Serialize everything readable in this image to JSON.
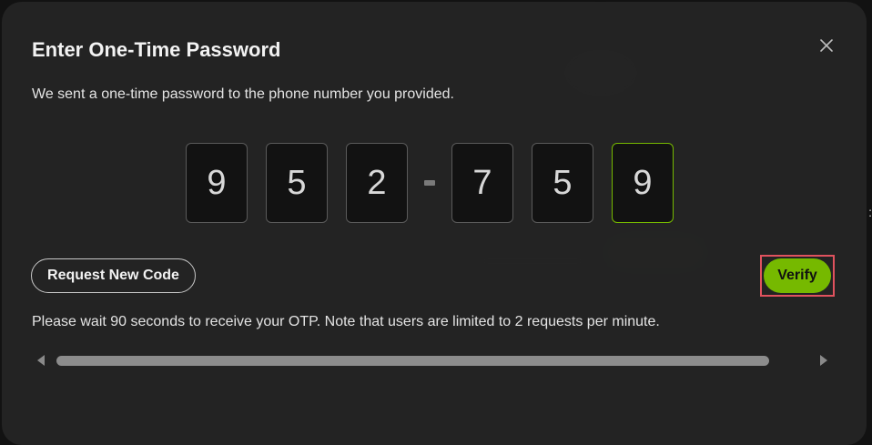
{
  "dialog": {
    "title": "Enter One-Time Password",
    "subtitle": "We sent a one-time password to the phone number you provided.",
    "close_icon": "close-icon",
    "otp": {
      "digits": [
        "9",
        "5",
        "2",
        "7",
        "5",
        "9"
      ],
      "separator": "-"
    },
    "request_new_code_label": "Request New Code",
    "verify_label": "Verify",
    "wait_message": "Please wait 90 seconds to receive your OTP. Note that users are limited to 2 requests per minute."
  },
  "colors": {
    "accent": "#76b900",
    "highlight_outline": "#e0525e",
    "modal_bg": "#242424"
  }
}
